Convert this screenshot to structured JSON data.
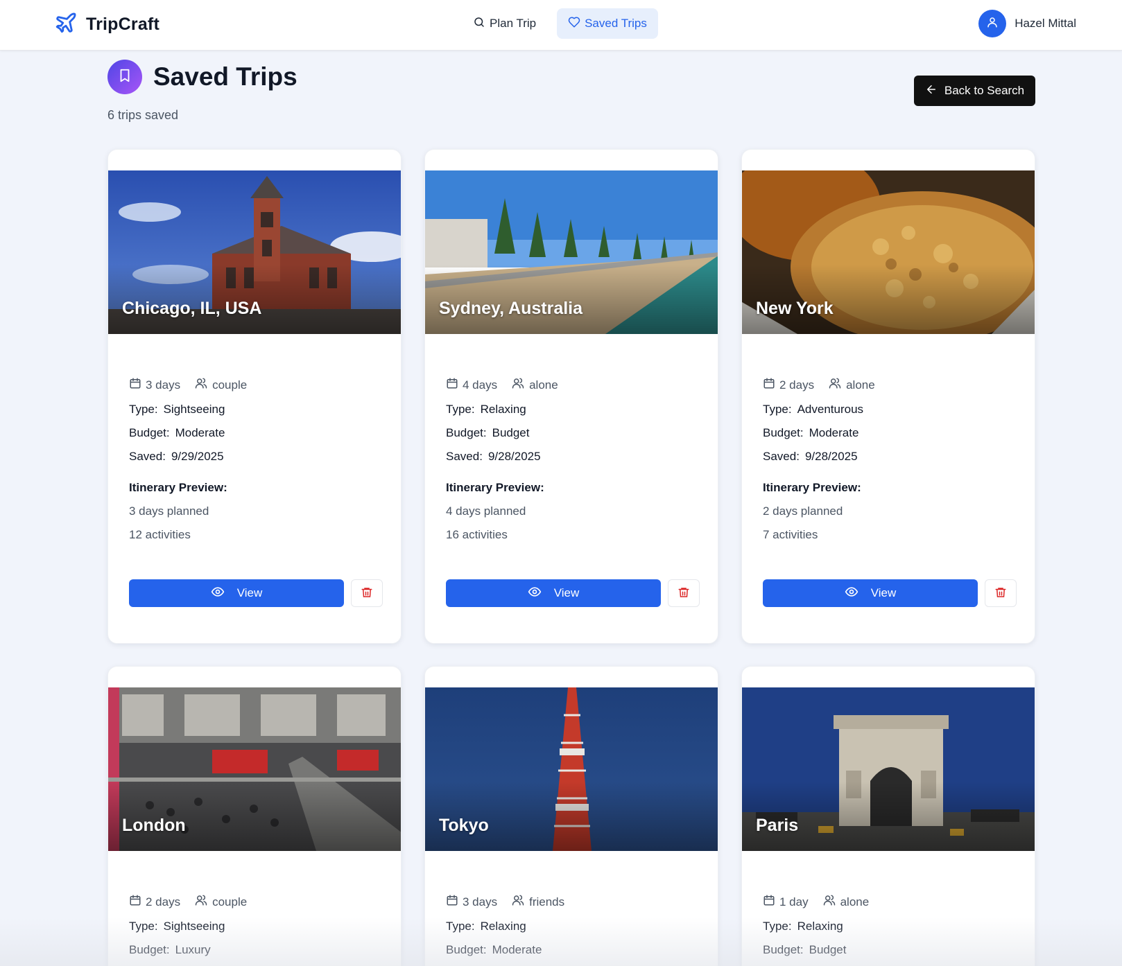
{
  "nav": {
    "brand": "TripCraft",
    "links": [
      {
        "label": "Plan Trip",
        "icon": "search-icon"
      },
      {
        "label": "Saved Trips",
        "icon": "heart-icon"
      }
    ],
    "user_name": "Hazel Mittal"
  },
  "header": {
    "title": "Saved Trips",
    "count_text": "6 trips saved",
    "back_label": "Back to Search"
  },
  "labels": {
    "type": "Type:",
    "budget": "Budget:",
    "saved": "Saved:",
    "preview": "Itinerary Preview:",
    "view": "View"
  },
  "trips": [
    {
      "place": "Chicago, IL, USA",
      "days": "3 days",
      "group": "couple",
      "type": "Sightseeing",
      "budget": "Moderate",
      "saved": "9/29/2025",
      "planned": "3 days planned",
      "activities": "12 activities"
    },
    {
      "place": "Sydney, Australia",
      "days": "4 days",
      "group": "alone",
      "type": "Relaxing",
      "budget": "Budget",
      "saved": "9/28/2025",
      "planned": "4 days planned",
      "activities": "16 activities"
    },
    {
      "place": "New York",
      "days": "2 days",
      "group": "alone",
      "type": "Adventurous",
      "budget": "Moderate",
      "saved": "9/28/2025",
      "planned": "2 days planned",
      "activities": "7 activities"
    },
    {
      "place": "London",
      "days": "2 days",
      "group": "couple",
      "type": "Sightseeing",
      "budget": "Luxury"
    },
    {
      "place": "Tokyo",
      "days": "3 days",
      "group": "friends",
      "type": "Relaxing",
      "budget": "Moderate"
    },
    {
      "place": "Paris",
      "days": "1 day",
      "group": "alone",
      "type": "Relaxing",
      "budget": "Budget"
    }
  ],
  "colors": {
    "primary": "#2563eb",
    "danger": "#dc2626",
    "page_bg": "#f1f4fb"
  }
}
